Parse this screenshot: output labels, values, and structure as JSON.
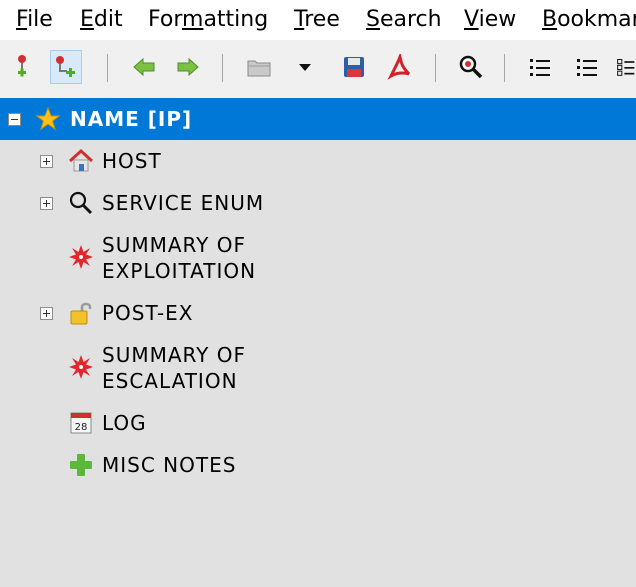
{
  "menu": {
    "items": [
      {
        "pre": "",
        "accel": "F",
        "post": "ile"
      },
      {
        "pre": "",
        "accel": "E",
        "post": "dit"
      },
      {
        "pre": "For",
        "accel": "m",
        "post": "atting"
      },
      {
        "pre": "",
        "accel": "T",
        "post": "ree"
      },
      {
        "pre": "",
        "accel": "S",
        "post": "earch"
      },
      {
        "pre": "",
        "accel": "V",
        "post": "iew"
      },
      {
        "pre": "",
        "accel": "B",
        "post": "ookmar"
      }
    ]
  },
  "tree": {
    "root": {
      "label": "NAME [IP]",
      "icon": "star-icon",
      "expanded": true,
      "selected": true
    },
    "children": [
      {
        "label": "HOST",
        "icon": "house-icon",
        "expander": "plus"
      },
      {
        "label": "SERVICE ENUM",
        "icon": "magnifier-icon",
        "expander": "plus"
      },
      {
        "label_line1": "SUMMARY OF",
        "label_line2": "EXPLOITATION",
        "icon": "red-burst-icon",
        "expander": "none"
      },
      {
        "label": "POST-EX",
        "icon": "padlock-icon",
        "expander": "plus"
      },
      {
        "label_line1": "SUMMARY OF",
        "label_line2": "ESCALATION",
        "icon": "red-burst-icon",
        "expander": "none"
      },
      {
        "label": "LOG",
        "icon": "calendar-icon",
        "calendar_day": "28",
        "expander": "none"
      },
      {
        "label": "MISC NOTES",
        "icon": "green-plus-icon",
        "expander": "none"
      }
    ]
  },
  "colors": {
    "selection": "#0078d7",
    "tree_background": "#e1e1e1",
    "toolbar_background": "#f0f0f0"
  }
}
